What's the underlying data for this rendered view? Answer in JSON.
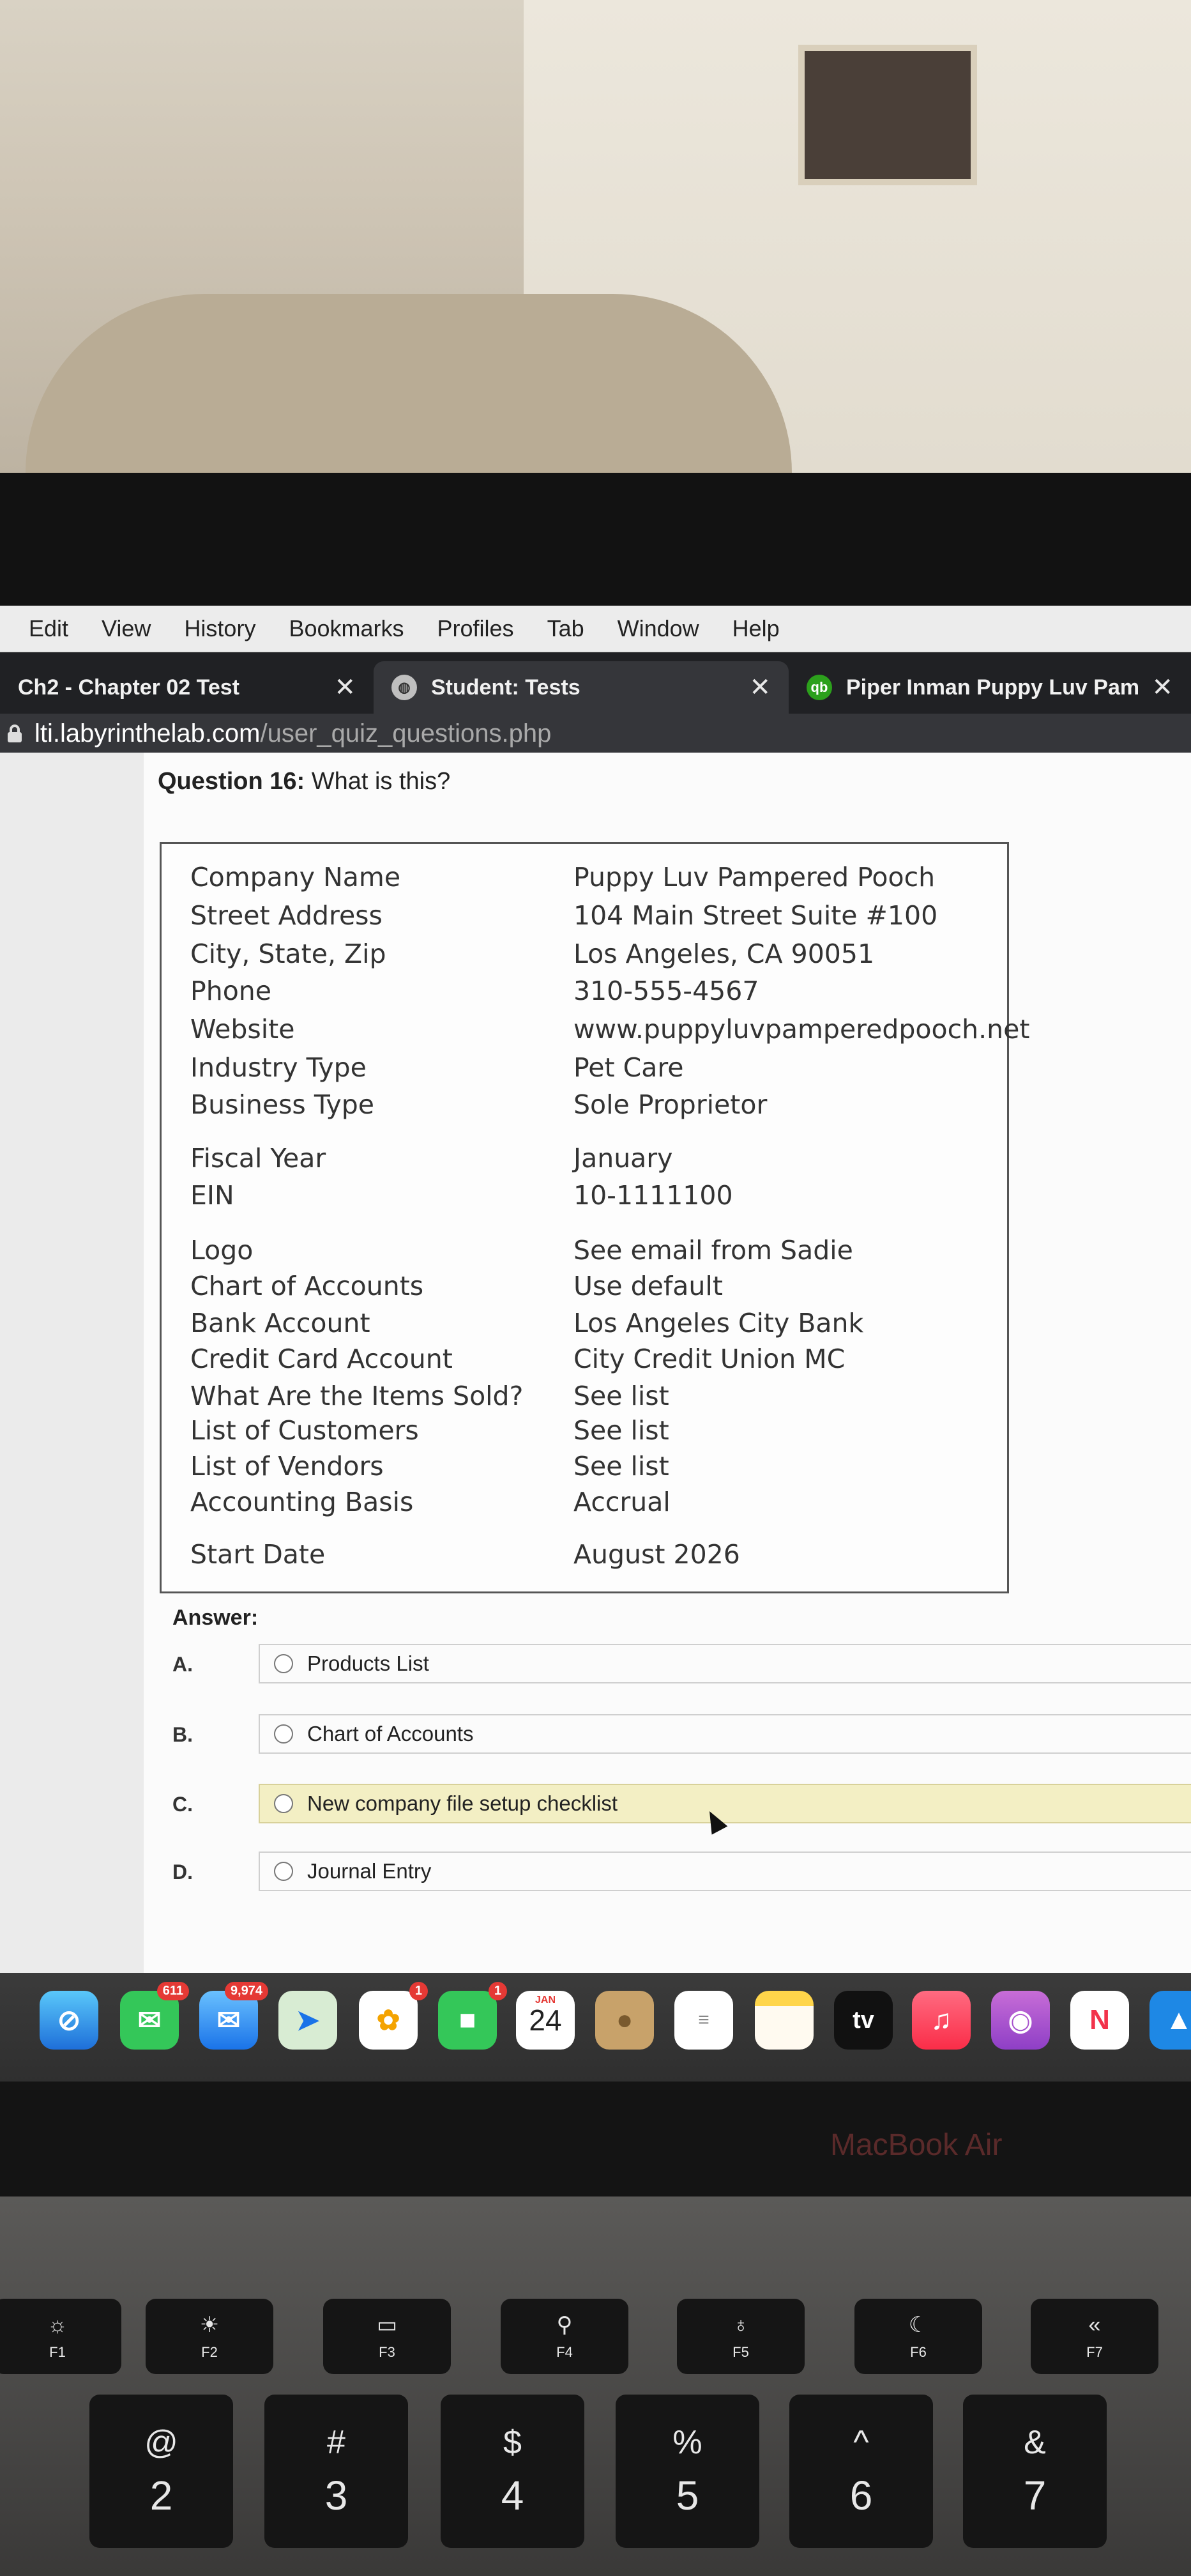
{
  "menu": [
    "Edit",
    "View",
    "History",
    "Bookmarks",
    "Profiles",
    "Tab",
    "Window",
    "Help"
  ],
  "tabs": [
    {
      "title": "Ch2 - Chapter 02 Test",
      "close": "✕"
    },
    {
      "title": "Student: Tests",
      "close": "✕"
    },
    {
      "title": "Piper Inman Puppy Luv Pamper",
      "close": "✕"
    }
  ],
  "address": {
    "domain": "lti.labyrinthelab.com",
    "path": "/user_quiz_questions.php"
  },
  "question": {
    "number": "Question 16:",
    "text": "What is this?"
  },
  "company_info": [
    {
      "label": "Company Name",
      "value": "Puppy Luv Pampered Pooch"
    },
    {
      "label": "Street Address",
      "value": "104 Main Street Suite #100"
    },
    {
      "label": "City, State, Zip",
      "value": "Los Angeles, CA 90051"
    },
    {
      "label": "Phone",
      "value": "310-555-4567"
    },
    {
      "label": "Website",
      "value": "www.puppyluvpamperedpooch.net"
    },
    {
      "label": "Industry Type",
      "value": "Pet Care"
    },
    {
      "label": "Business Type",
      "value": "Sole Proprietor"
    },
    {
      "label": "Fiscal Year",
      "value": "January"
    },
    {
      "label": "EIN",
      "value": "10-1111100"
    },
    {
      "label": "Logo",
      "value": "See email from Sadie"
    },
    {
      "label": "Chart of Accounts",
      "value": "Use default"
    },
    {
      "label": "Bank Account",
      "value": "Los Angeles City Bank"
    },
    {
      "label": "Credit Card Account",
      "value": "City Credit Union MC"
    },
    {
      "label": "What Are the Items Sold?",
      "value": "See list"
    },
    {
      "label": "List of Customers",
      "value": "See list"
    },
    {
      "label": "List of Vendors",
      "value": "See list"
    },
    {
      "label": "Accounting Basis",
      "value": "Accrual"
    },
    {
      "label": "Start Date",
      "value": "August 2026"
    }
  ],
  "answer_label": "Answer:",
  "options": [
    {
      "letter": "A.",
      "text": "Products List"
    },
    {
      "letter": "B.",
      "text": "Chart of Accounts"
    },
    {
      "letter": "C.",
      "text": "New company file setup checklist"
    },
    {
      "letter": "D.",
      "text": "Journal Entry"
    }
  ],
  "dock": {
    "messages_badge": "611",
    "mail_badge": "9,974",
    "photos_badge": "1",
    "facetime_badge": "1",
    "calendar_month": "JAN",
    "calendar_day": "24",
    "tv_label": "tv"
  },
  "brand": "MacBook Air",
  "fkeys": [
    {
      "label": "F1",
      "icon": "brightness-down-icon"
    },
    {
      "label": "F2",
      "icon": "brightness-up-icon"
    },
    {
      "label": "F3",
      "icon": "mission-control-icon"
    },
    {
      "label": "F4",
      "icon": "search-icon"
    },
    {
      "label": "F5",
      "icon": "microphone-icon"
    },
    {
      "label": "F6",
      "icon": "moon-icon"
    },
    {
      "label": "F7",
      "icon": "rewind-icon"
    }
  ],
  "numkeys": [
    {
      "top": "@",
      "bottom": "2"
    },
    {
      "top": "#",
      "bottom": "3"
    },
    {
      "top": "$",
      "bottom": "4"
    },
    {
      "top": "%",
      "bottom": "5"
    },
    {
      "top": "^",
      "bottom": "6"
    },
    {
      "top": "&",
      "bottom": "7"
    }
  ],
  "colors": {
    "highlight": "#f3efc4",
    "tabbar": "#202124",
    "active_tab": "#35363a"
  }
}
